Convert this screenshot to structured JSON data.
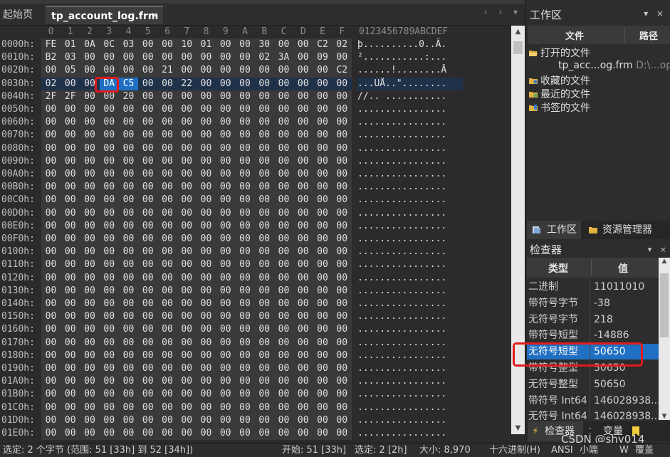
{
  "tabs": {
    "start": "起始页",
    "file": "tp_account_log.frm",
    "close": "×",
    "nav": "‹ › ▾"
  },
  "hex": {
    "col_headers": [
      "0",
      "1",
      "2",
      "3",
      "4",
      "5",
      "6",
      "7",
      "8",
      "9",
      "A",
      "B",
      "C",
      "D",
      "E",
      "F"
    ],
    "ascii_header": "0123456789ABCDEF",
    "rows": [
      {
        "addr": "0000h:",
        "bytes": [
          "FE",
          "01",
          "0A",
          "0C",
          "03",
          "00",
          "00",
          "10",
          "01",
          "00",
          "00",
          "30",
          "00",
          "00",
          "C2",
          "02"
        ],
        "ascii": "þ..........0..Â."
      },
      {
        "addr": "0010h:",
        "bytes": [
          "B2",
          "03",
          "00",
          "00",
          "00",
          "00",
          "00",
          "00",
          "00",
          "00",
          "00",
          "02",
          "3A",
          "00",
          "09",
          "00"
        ],
        "ascii": "²...........:..."
      },
      {
        "addr": "0020h:",
        "bytes": [
          "00",
          "05",
          "00",
          "00",
          "00",
          "00",
          "21",
          "00",
          "00",
          "00",
          "00",
          "00",
          "00",
          "00",
          "00",
          "C2"
        ],
        "ascii": "......!........Â"
      },
      {
        "addr": "0030h:",
        "bytes": [
          "02",
          "00",
          "00",
          "DA",
          "C5",
          "00",
          "00",
          "22",
          "00",
          "00",
          "00",
          "00",
          "00",
          "00",
          "00",
          "00"
        ],
        "ascii": "...ÚÅ..\"........"
      },
      {
        "addr": "0040h:",
        "bytes": [
          "2F",
          "2F",
          "00",
          "00",
          "20",
          "00",
          "00",
          "00",
          "00",
          "00",
          "00",
          "00",
          "00",
          "00",
          "00",
          "00"
        ],
        "ascii": "//.. ..........."
      },
      {
        "addr": "0050h:",
        "bytes": [
          "00",
          "00",
          "00",
          "00",
          "00",
          "00",
          "00",
          "00",
          "00",
          "00",
          "00",
          "00",
          "00",
          "00",
          "00",
          "00"
        ],
        "ascii": "................"
      },
      {
        "addr": "0060h:",
        "bytes": [
          "00",
          "00",
          "00",
          "00",
          "00",
          "00",
          "00",
          "00",
          "00",
          "00",
          "00",
          "00",
          "00",
          "00",
          "00",
          "00"
        ],
        "ascii": "................"
      },
      {
        "addr": "0070h:",
        "bytes": [
          "00",
          "00",
          "00",
          "00",
          "00",
          "00",
          "00",
          "00",
          "00",
          "00",
          "00",
          "00",
          "00",
          "00",
          "00",
          "00"
        ],
        "ascii": "................"
      },
      {
        "addr": "0080h:",
        "bytes": [
          "00",
          "00",
          "00",
          "00",
          "00",
          "00",
          "00",
          "00",
          "00",
          "00",
          "00",
          "00",
          "00",
          "00",
          "00",
          "00"
        ],
        "ascii": "................"
      },
      {
        "addr": "0090h:",
        "bytes": [
          "00",
          "00",
          "00",
          "00",
          "00",
          "00",
          "00",
          "00",
          "00",
          "00",
          "00",
          "00",
          "00",
          "00",
          "00",
          "00"
        ],
        "ascii": "................"
      },
      {
        "addr": "00A0h:",
        "bytes": [
          "00",
          "00",
          "00",
          "00",
          "00",
          "00",
          "00",
          "00",
          "00",
          "00",
          "00",
          "00",
          "00",
          "00",
          "00",
          "00"
        ],
        "ascii": "................"
      },
      {
        "addr": "00B0h:",
        "bytes": [
          "00",
          "00",
          "00",
          "00",
          "00",
          "00",
          "00",
          "00",
          "00",
          "00",
          "00",
          "00",
          "00",
          "00",
          "00",
          "00"
        ],
        "ascii": "................"
      },
      {
        "addr": "00C0h:",
        "bytes": [
          "00",
          "00",
          "00",
          "00",
          "00",
          "00",
          "00",
          "00",
          "00",
          "00",
          "00",
          "00",
          "00",
          "00",
          "00",
          "00"
        ],
        "ascii": "................"
      },
      {
        "addr": "00D0h:",
        "bytes": [
          "00",
          "00",
          "00",
          "00",
          "00",
          "00",
          "00",
          "00",
          "00",
          "00",
          "00",
          "00",
          "00",
          "00",
          "00",
          "00"
        ],
        "ascii": "................"
      },
      {
        "addr": "00E0h:",
        "bytes": [
          "00",
          "00",
          "00",
          "00",
          "00",
          "00",
          "00",
          "00",
          "00",
          "00",
          "00",
          "00",
          "00",
          "00",
          "00",
          "00"
        ],
        "ascii": "................"
      },
      {
        "addr": "00F0h:",
        "bytes": [
          "00",
          "00",
          "00",
          "00",
          "00",
          "00",
          "00",
          "00",
          "00",
          "00",
          "00",
          "00",
          "00",
          "00",
          "00",
          "00"
        ],
        "ascii": "................"
      },
      {
        "addr": "0100h:",
        "bytes": [
          "00",
          "00",
          "00",
          "00",
          "00",
          "00",
          "00",
          "00",
          "00",
          "00",
          "00",
          "00",
          "00",
          "00",
          "00",
          "00"
        ],
        "ascii": "................"
      },
      {
        "addr": "0110h:",
        "bytes": [
          "00",
          "00",
          "00",
          "00",
          "00",
          "00",
          "00",
          "00",
          "00",
          "00",
          "00",
          "00",
          "00",
          "00",
          "00",
          "00"
        ],
        "ascii": "................"
      },
      {
        "addr": "0120h:",
        "bytes": [
          "00",
          "00",
          "00",
          "00",
          "00",
          "00",
          "00",
          "00",
          "00",
          "00",
          "00",
          "00",
          "00",
          "00",
          "00",
          "00"
        ],
        "ascii": "................"
      },
      {
        "addr": "0130h:",
        "bytes": [
          "00",
          "00",
          "00",
          "00",
          "00",
          "00",
          "00",
          "00",
          "00",
          "00",
          "00",
          "00",
          "00",
          "00",
          "00",
          "00"
        ],
        "ascii": "................"
      },
      {
        "addr": "0140h:",
        "bytes": [
          "00",
          "00",
          "00",
          "00",
          "00",
          "00",
          "00",
          "00",
          "00",
          "00",
          "00",
          "00",
          "00",
          "00",
          "00",
          "00"
        ],
        "ascii": "................"
      },
      {
        "addr": "0150h:",
        "bytes": [
          "00",
          "00",
          "00",
          "00",
          "00",
          "00",
          "00",
          "00",
          "00",
          "00",
          "00",
          "00",
          "00",
          "00",
          "00",
          "00"
        ],
        "ascii": "................"
      },
      {
        "addr": "0160h:",
        "bytes": [
          "00",
          "00",
          "00",
          "00",
          "00",
          "00",
          "00",
          "00",
          "00",
          "00",
          "00",
          "00",
          "00",
          "00",
          "00",
          "00"
        ],
        "ascii": "................"
      },
      {
        "addr": "0170h:",
        "bytes": [
          "00",
          "00",
          "00",
          "00",
          "00",
          "00",
          "00",
          "00",
          "00",
          "00",
          "00",
          "00",
          "00",
          "00",
          "00",
          "00"
        ],
        "ascii": "................"
      },
      {
        "addr": "0180h:",
        "bytes": [
          "00",
          "00",
          "00",
          "00",
          "00",
          "00",
          "00",
          "00",
          "00",
          "00",
          "00",
          "00",
          "00",
          "00",
          "00",
          "00"
        ],
        "ascii": "................"
      },
      {
        "addr": "0190h:",
        "bytes": [
          "00",
          "00",
          "00",
          "00",
          "00",
          "00",
          "00",
          "00",
          "00",
          "00",
          "00",
          "00",
          "00",
          "00",
          "00",
          "00"
        ],
        "ascii": "................"
      },
      {
        "addr": "01A0h:",
        "bytes": [
          "00",
          "00",
          "00",
          "00",
          "00",
          "00",
          "00",
          "00",
          "00",
          "00",
          "00",
          "00",
          "00",
          "00",
          "00",
          "00"
        ],
        "ascii": "................"
      },
      {
        "addr": "01B0h:",
        "bytes": [
          "00",
          "00",
          "00",
          "00",
          "00",
          "00",
          "00",
          "00",
          "00",
          "00",
          "00",
          "00",
          "00",
          "00",
          "00",
          "00"
        ],
        "ascii": "................"
      },
      {
        "addr": "01C0h:",
        "bytes": [
          "00",
          "00",
          "00",
          "00",
          "00",
          "00",
          "00",
          "00",
          "00",
          "00",
          "00",
          "00",
          "00",
          "00",
          "00",
          "00"
        ],
        "ascii": "................"
      },
      {
        "addr": "01D0h:",
        "bytes": [
          "00",
          "00",
          "00",
          "00",
          "00",
          "00",
          "00",
          "00",
          "00",
          "00",
          "00",
          "00",
          "00",
          "00",
          "00",
          "00"
        ],
        "ascii": "................"
      },
      {
        "addr": "01E0h:",
        "bytes": [
          "00",
          "00",
          "00",
          "00",
          "00",
          "00",
          "00",
          "00",
          "00",
          "00",
          "00",
          "00",
          "00",
          "00",
          "00",
          "00"
        ],
        "ascii": "................"
      }
    ],
    "selected_row": 3,
    "selected_bytes": [
      3,
      4
    ]
  },
  "workspace": {
    "title": "工作区",
    "controls": "▾ ×",
    "col_file": "文件",
    "col_path": "路径",
    "open_files": "打开的文件",
    "open_file_name": "tp_acc...og.frm",
    "open_file_path": "D:\\...op\\",
    "favorites": "收藏的文件",
    "recent": "最近的文件",
    "bookmarks": "书签的文件",
    "tab_workspace": "工作区",
    "tab_explorer": "资源管理器"
  },
  "inspector": {
    "title": "检查器",
    "controls": "▾ ×",
    "col_type": "类型",
    "col_value": "值",
    "rows": [
      {
        "type": "二进制",
        "value": "11011010"
      },
      {
        "type": "带符号字节",
        "value": "-38"
      },
      {
        "type": "无符号字节",
        "value": "218"
      },
      {
        "type": "带符号短型",
        "value": "-14886"
      },
      {
        "type": "无符号短型",
        "value": "50650"
      },
      {
        "type": "带符号整型",
        "value": "50650"
      },
      {
        "type": "无符号整型",
        "value": "50650"
      },
      {
        "type": "带符号 Int64",
        "value": "146028938..."
      },
      {
        "type": "无符号 Int64",
        "value": "146028938..."
      }
    ],
    "selected_index": 4,
    "tab_inspector": "检查器",
    "tab_variables": "变量"
  },
  "watermark": "CSDN @shy014",
  "status": {
    "selection": "选定: 2 个字节 (范围: 51 [33h] 到 52 [34h])",
    "start": "开始: 51 [33h]",
    "selected": "选定: 2 [2h]",
    "size": "大小: 8,970",
    "mode": "十六进制(H)",
    "encoding": "ANSI",
    "endian": "小端",
    "w": "W",
    "overwrite": "覆盖"
  },
  "colors": {
    "accent": "#1f6fc2",
    "annotation_red": "#e01b1b",
    "background": "#2b2b2b"
  }
}
